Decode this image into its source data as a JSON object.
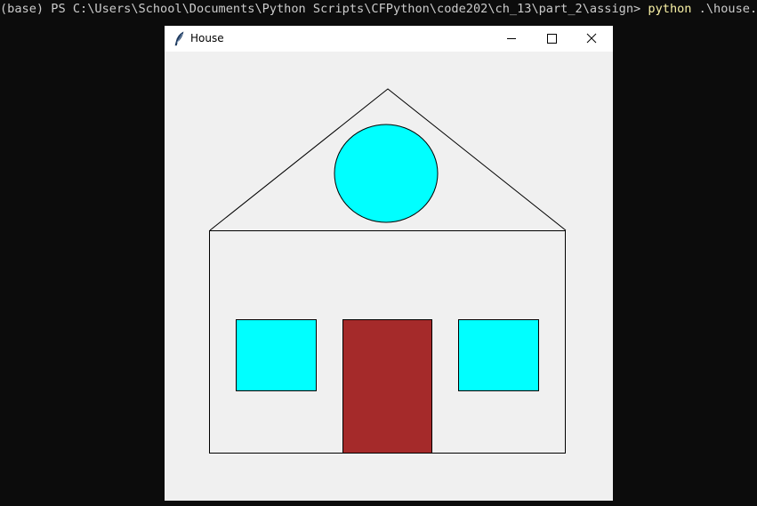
{
  "terminal": {
    "prompt": "(base) PS C:\\Users\\School\\Documents\\Python Scripts\\CFPython\\code202\\ch_13\\part_2\\assign> ",
    "command": "python",
    "argument": " .\\house.py"
  },
  "window": {
    "title": "House",
    "icon": "feather-icon",
    "controls": {
      "minimize": "minimize-icon",
      "maximize": "maximize-icon",
      "close": "close-icon"
    }
  },
  "drawing": {
    "colors": {
      "background": "#f0f0f0",
      "outline": "#000000",
      "window_fill": "#00ffff",
      "attic_window_fill": "#00ffff",
      "door_fill": "#a52a2a",
      "wall_fill": "#f0f0f0"
    }
  }
}
